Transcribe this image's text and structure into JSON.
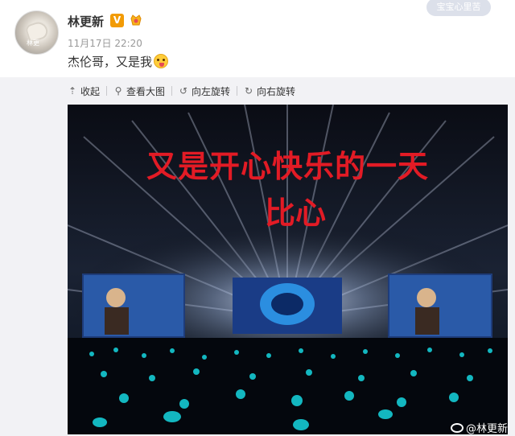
{
  "post": {
    "username": "林更新",
    "verified_badge": "V",
    "timestamp": "11月17日 22:20",
    "text": "杰伦哥，又是我",
    "stamp": "宝宝心里苦",
    "avatar_tag": "林更"
  },
  "toolbar": {
    "collapse_label": "收起",
    "view_large_label": "查看大图",
    "rotate_left_label": "向左旋转",
    "rotate_right_label": "向右旋转"
  },
  "photo": {
    "overlay_line1": "又是开心快乐的一天",
    "overlay_line2": "比心",
    "watermark": "@林更新"
  },
  "colors": {
    "overlay_text": "#e21b25",
    "badge": "#f29b05",
    "toolbar_bg": "#f2f2f5"
  }
}
